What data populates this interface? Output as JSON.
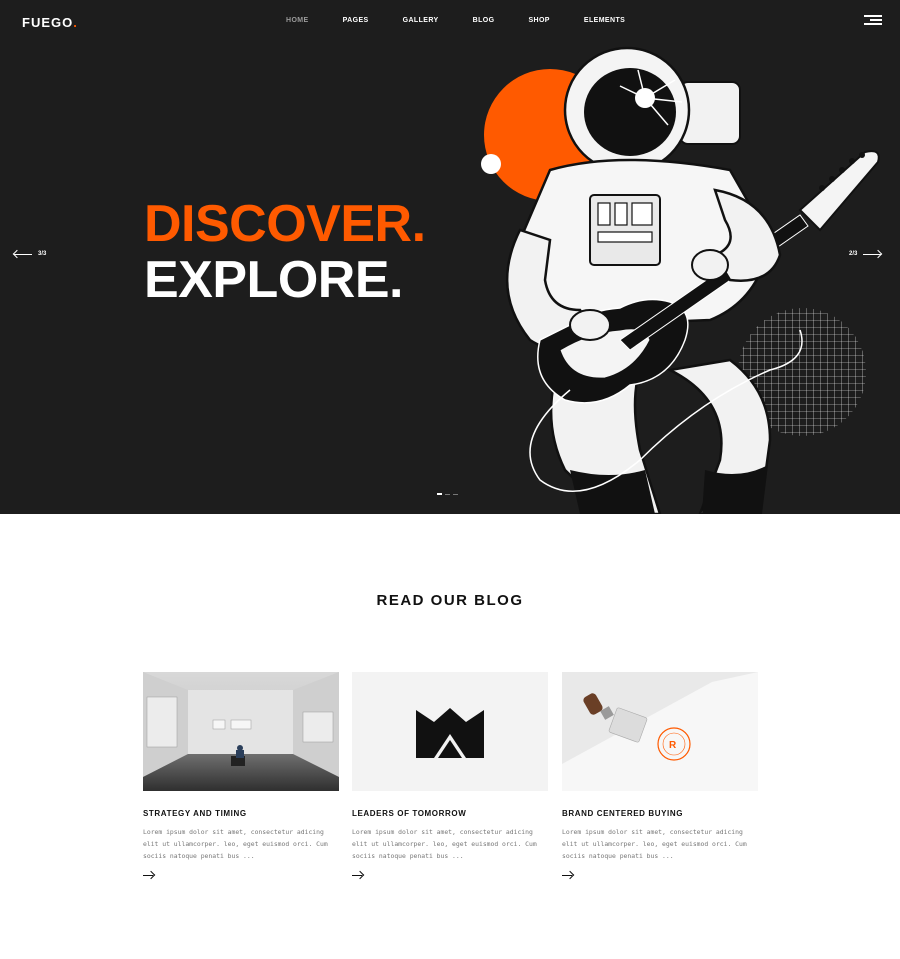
{
  "brand": {
    "name": "FUEGO",
    "dot": ".",
    "accent": "#ff5a00"
  },
  "nav": {
    "items": [
      {
        "label": "HOME",
        "active": true
      },
      {
        "label": "PAGES",
        "active": false
      },
      {
        "label": "GALLERY",
        "active": false
      },
      {
        "label": "BLOG",
        "active": false
      },
      {
        "label": "SHOP",
        "active": false
      },
      {
        "label": "ELEMENTS",
        "active": false
      }
    ],
    "menu_icon": "hamburger-icon"
  },
  "hero": {
    "line1": "DISCOVER.",
    "line2": "EXPLORE.",
    "prev_label": "3/3",
    "next_label": "2/3",
    "slides": 3,
    "active_slide": 1,
    "background": "#1d1d1d"
  },
  "blog": {
    "title": "READ OUR BLOG",
    "posts": [
      {
        "title": "STRATEGY AND TIMING",
        "excerpt": "Lorem ipsum dolor sit amet, consectetur adicing elit ut ullamcorper. leo, eget euismod orci. Cum sociis natoque penati bus ...",
        "image": "gallery-photo"
      },
      {
        "title": "LEADERS OF TOMORROW",
        "excerpt": "Lorem ipsum dolor sit amet, consectetur adicing elit ut ullamcorper. leo, eget euismod orci. Cum sociis natoque penati bus ...",
        "image": "crown-logo"
      },
      {
        "title": "BRAND CENTERED BUYING",
        "excerpt": "Lorem ipsum dolor sit amet, consectetur adicing elit ut ullamcorper. leo, eget euismod orci. Cum sociis natoque penati bus ...",
        "image": "stamp-photo"
      }
    ],
    "read_more_icon": "arrow-right-icon"
  }
}
